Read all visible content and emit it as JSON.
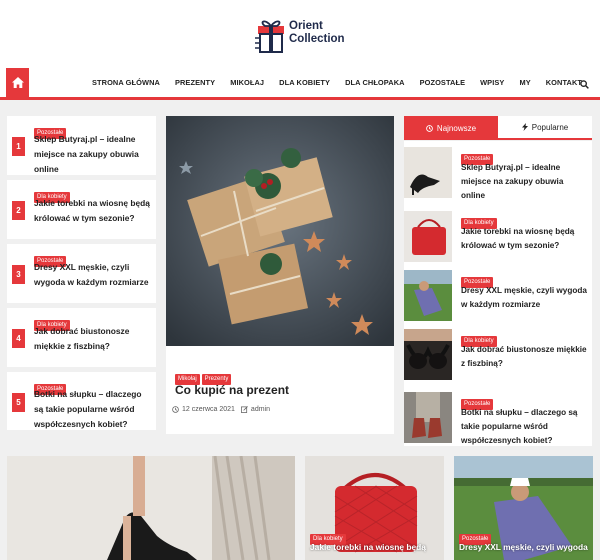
{
  "brand": {
    "line1": "Orient",
    "line2": "Collection"
  },
  "nav": {
    "items": [
      "STRONA GŁÓWNA",
      "PREZENTY",
      "MIKOŁAJ",
      "DLA KOBIETY",
      "DLA CHŁOPAKA",
      "POZOSTAŁE",
      "WPISY",
      "MY",
      "KONTAKT"
    ]
  },
  "left_list": [
    {
      "num": "1",
      "category": "Pozostałe",
      "title": "Sklep Butyraj.pl – idealne miejsce na zakupy obuwia online"
    },
    {
      "num": "2",
      "category": "Dla kobiety",
      "title": "Jakie torebki na wiosnę będą królować w tym sezonie?"
    },
    {
      "num": "3",
      "category": "Pozostałe",
      "title": "Dresy XXL męskie, czyli wygoda w każdym rozmiarze"
    },
    {
      "num": "4",
      "category": "Dla kobiety",
      "title": "Jak dobrać biustonosze miękkie z fiszbiną?"
    },
    {
      "num": "5",
      "category": "Pozostałe",
      "title": "Botki na słupku – dlaczego są takie popularne wśród współczesnych kobiet?"
    }
  ],
  "feature": {
    "categories": [
      "Mikołaj",
      "Prezenty"
    ],
    "title": "Co kupić na prezent",
    "date": "12 czerwca 2021",
    "author": "admin"
  },
  "tabs": {
    "newest": "Najnowsze",
    "popular": "Popularne"
  },
  "right_list": [
    {
      "category": "Pozostałe",
      "title": "Sklep Butyraj.pl – idealne miejsce na zakupy obuwia online"
    },
    {
      "category": "Dla kobiety",
      "title": "Jakie torebki na wiosnę będą królować w tym sezonie?"
    },
    {
      "category": "Pozostałe",
      "title": "Dresy XXL męskie, czyli wygoda w każdym rozmiarze"
    },
    {
      "category": "Dla kobiety",
      "title": "Jak dobrać biustonosze miękkie z fiszbiną?"
    },
    {
      "category": "Pozostałe",
      "title": "Botki na słupku – dlaczego są takie popularne wśród współczesnych kobiet?"
    }
  ],
  "bottom": [
    {
      "category": "",
      "title": ""
    },
    {
      "category": "Dla kobiety",
      "title": "Jakie torebki na wiosnę będą"
    },
    {
      "category": "Pozostałe",
      "title": "Dresy XXL męskie, czyli wygoda"
    }
  ],
  "colors": {
    "accent": "#e5383b",
    "navy": "#1f2a4a"
  },
  "icons": {
    "home": "home-icon",
    "search": "search-icon",
    "clock": "clock-icon",
    "bolt": "bolt-icon",
    "calendar": "calendar-icon",
    "edit": "edit-icon"
  }
}
